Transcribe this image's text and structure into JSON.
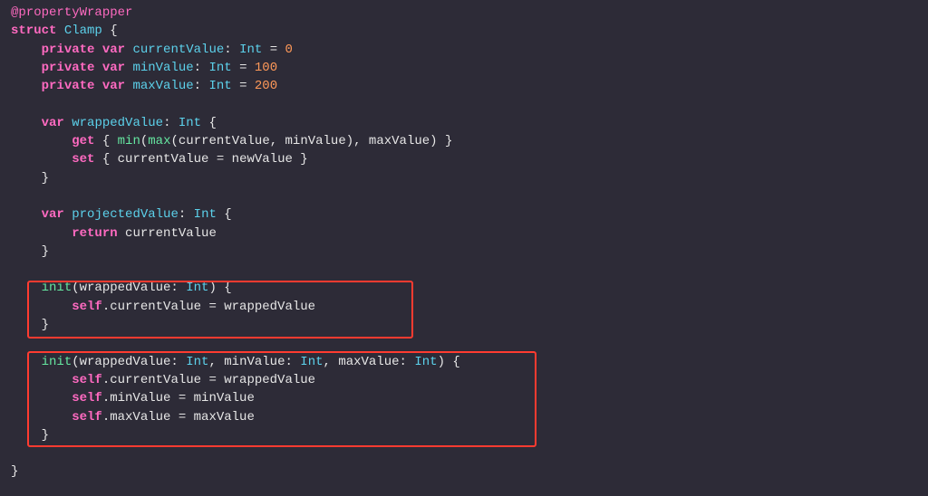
{
  "code": {
    "l1a": "@propertyWrapper",
    "l2a": "struct",
    "l2b": "Clamp",
    "l2c": "{",
    "l3a": "private var",
    "l3b": "currentValue",
    "l3c": ":",
    "l3d": "Int",
    "l3e": "=",
    "l3f": "0",
    "l4a": "private var",
    "l4b": "minValue",
    "l4c": ":",
    "l4d": "Int",
    "l4e": "=",
    "l4f": "100",
    "l5a": "private var",
    "l5b": "maxValue",
    "l5c": ":",
    "l5d": "Int",
    "l5e": "=",
    "l5f": "200",
    "l7a": "var",
    "l7b": "wrappedValue",
    "l7c": ":",
    "l7d": "Int",
    "l7e": "{",
    "l8a": "get",
    "l8b": "{",
    "l8c": "min",
    "l8d": "(",
    "l8e": "max",
    "l8f": "(currentValue, minValue), maxValue) }",
    "l9a": "set",
    "l9b": "{ currentValue = newValue }",
    "l10a": "}",
    "l12a": "var",
    "l12b": "projectedValue",
    "l12c": ":",
    "l12d": "Int",
    "l12e": "{",
    "l13a": "return",
    "l13b": "currentValue",
    "l14a": "}",
    "l16a": "init",
    "l16b": "(wrappedValue:",
    "l16c": "Int",
    "l16d": ") {",
    "l17a": "self",
    "l17b": ".currentValue = wrappedValue",
    "l18a": "}",
    "l20a": "init",
    "l20b": "(wrappedValue:",
    "l20c": "Int",
    "l20d": ", minValue:",
    "l20e": "Int",
    "l20f": ", maxValue:",
    "l20g": "Int",
    "l20h": ") {",
    "l21a": "self",
    "l21b": ".currentValue = wrappedValue",
    "l22a": "self",
    "l22b": ".minValue = minValue",
    "l23a": "self",
    "l23b": ".maxValue = maxValue",
    "l24a": "}",
    "l26a": "}"
  }
}
